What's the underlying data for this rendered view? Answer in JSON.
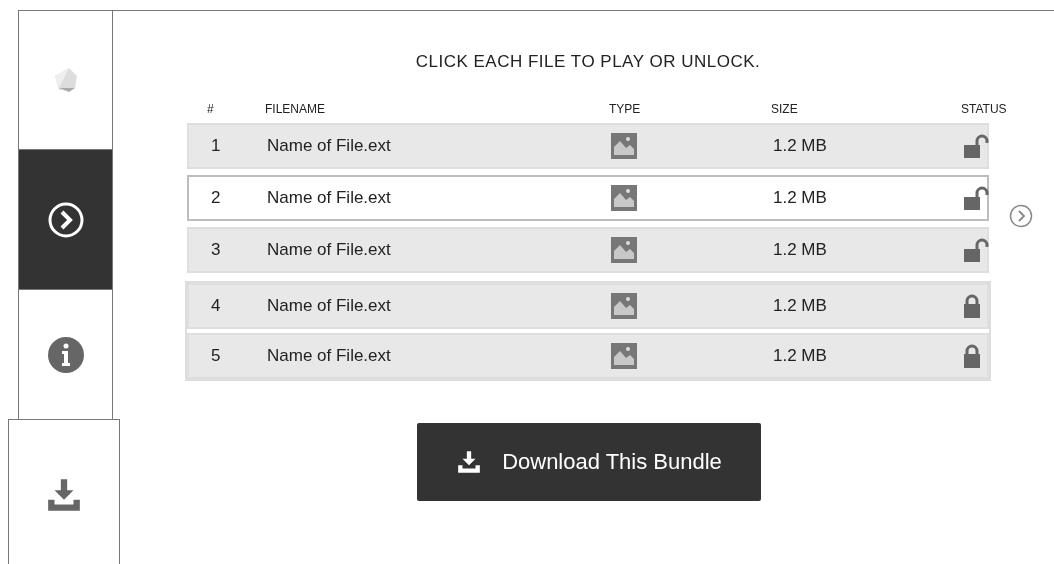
{
  "sidebar": {
    "tabs": [
      {
        "kind": "logo",
        "selected": false
      },
      {
        "kind": "next",
        "selected": true
      },
      {
        "kind": "info",
        "selected": false
      },
      {
        "kind": "download",
        "selected": false
      }
    ]
  },
  "instruction": "CLICK EACH FILE TO PLAY OR UNLOCK.",
  "table": {
    "columns": [
      "#",
      "FILENAME",
      "TYPE",
      "SIZE",
      "STATUS"
    ],
    "rows": [
      {
        "number": "1",
        "filename": "Name of File.ext",
        "size": "1.2 MB",
        "locked": false,
        "selected": false
      },
      {
        "number": "2",
        "filename": "Name of File.ext",
        "size": "1.2 MB",
        "locked": false,
        "selected": true
      },
      {
        "number": "3",
        "filename": "Name of File.ext",
        "size": "1.2 MB",
        "locked": false,
        "selected": false
      },
      {
        "number": "4",
        "filename": "Name of File.ext",
        "size": "1.2 MB",
        "locked": true,
        "selected": false
      },
      {
        "number": "5",
        "filename": "Name of File.ext",
        "size": "1.2 MB",
        "locked": true,
        "selected": false
      }
    ]
  },
  "download_button": "Download This Bundle"
}
